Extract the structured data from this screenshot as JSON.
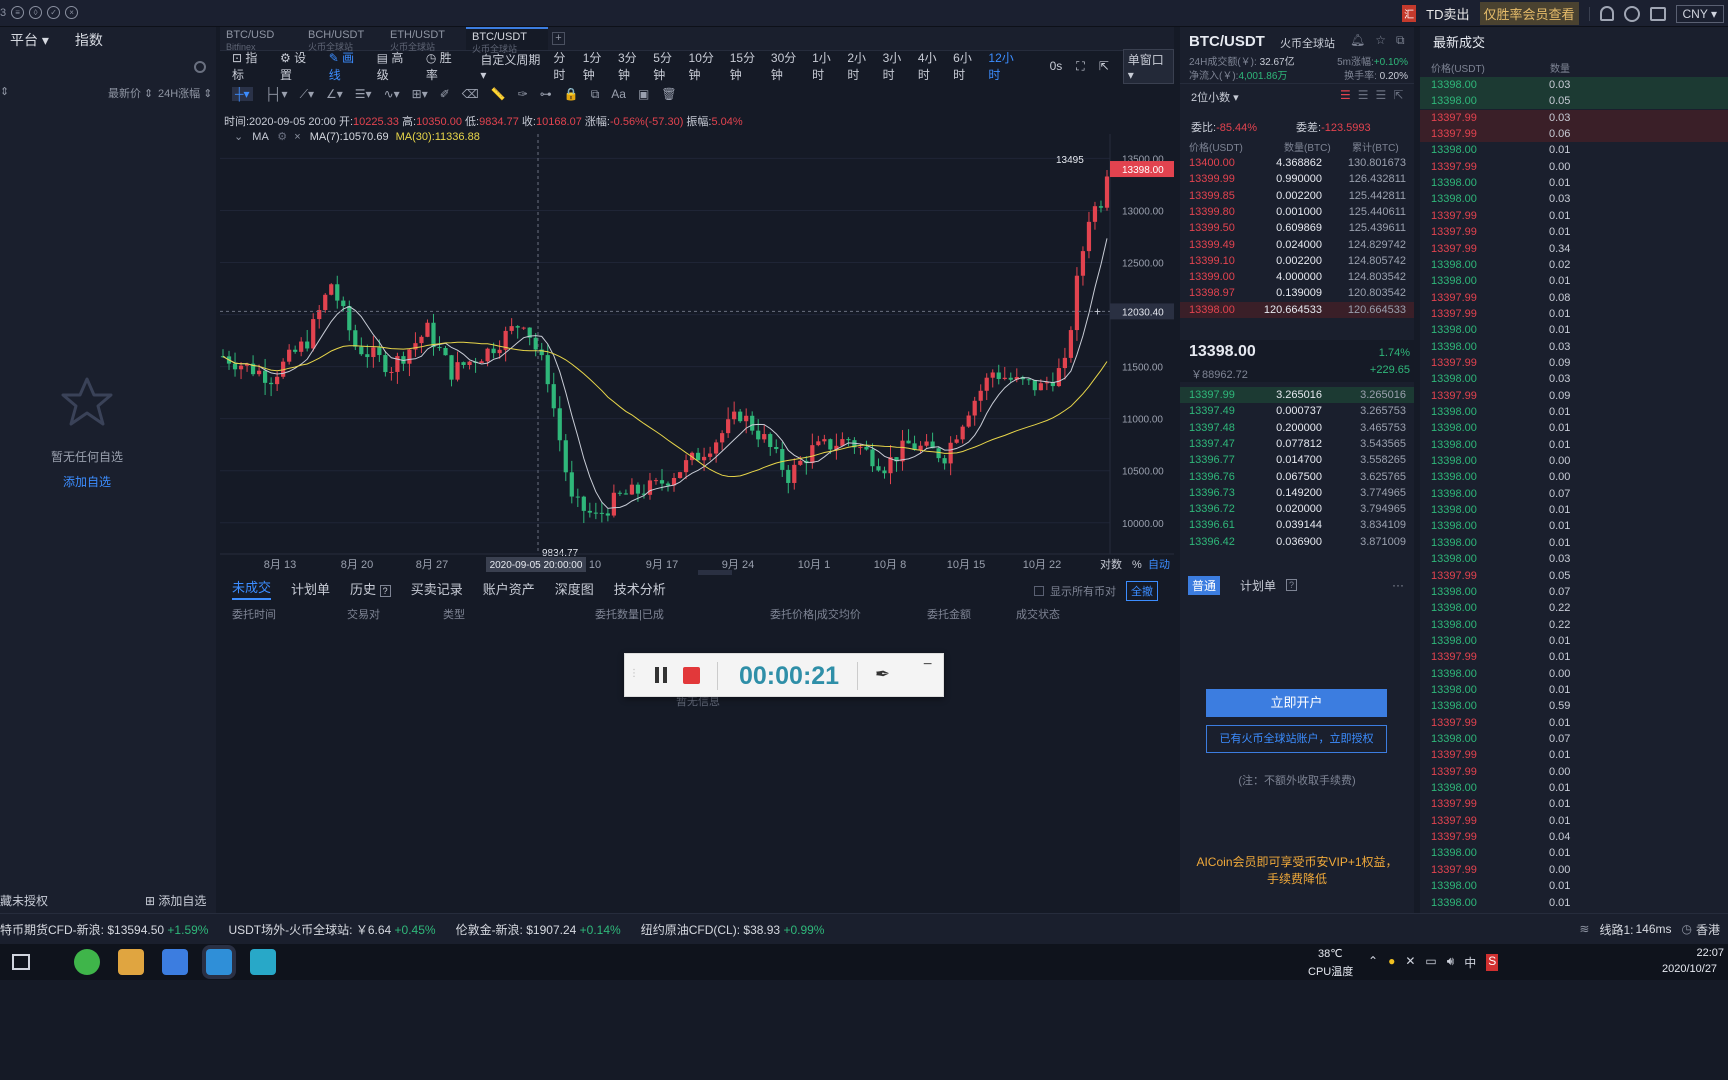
{
  "topbar": {
    "td_badge": "汇",
    "td_label": "TD卖出",
    "vip": "仅胜率会员查看",
    "currency": "CNY ▾"
  },
  "left": {
    "tabs": [
      "平台 ▾",
      "指数"
    ],
    "col_last": "最新价 ⇕",
    "col_change": "24H涨幅 ⇕",
    "empty_text": "暂无任何自选",
    "add_link": "添加自选",
    "bottom_left": "藏未授权",
    "bottom_add": "添加自选"
  },
  "chart": {
    "tabs": [
      {
        "name": "BTC/USD",
        "sub": "Bitfinex"
      },
      {
        "name": "BCH/USDT",
        "sub": "火币全球站"
      },
      {
        "name": "ETH/USDT",
        "sub": "火币全球站"
      },
      {
        "name": "BTC/USDT",
        "sub": "火币全球站"
      }
    ],
    "tools": [
      "指标",
      "设置",
      "画线",
      "高级",
      "胜率"
    ],
    "custom_period": "自定义周期 ▾",
    "periods": [
      "分时",
      "1分钟",
      "3分钟",
      "5分钟",
      "10分钟",
      "15分钟",
      "30分钟",
      "1小时",
      "2小时",
      "3小时",
      "4小时",
      "6小时",
      "12小时"
    ],
    "active_period": "12小时",
    "right_tools": {
      "zero": "0s",
      "single": "单窗口 ▾"
    },
    "ohlc": {
      "time": "时间:2020-09-05 20:00",
      "open_l": "开:",
      "open": "10225.33",
      "high_l": "高:",
      "high": "10350.00",
      "low_l": "低:",
      "low": "9834.77",
      "close_l": "收:",
      "close": "10168.07",
      "chg_l": "涨幅:",
      "chg": "-0.56%(-57.30)",
      "amp_l": "振幅:",
      "amp": "5.04%"
    },
    "ma": {
      "name": "MA",
      "ma7": "MA(7):10570.69",
      "ma30": "MA(30):11336.88"
    },
    "price_ticks": [
      "13500.00",
      "13000.00",
      "12500.00",
      "12000.00",
      "11500.00",
      "11000.00",
      "10500.00",
      "10000.00"
    ],
    "current_price": "13398.00",
    "cross_price": "12030.40",
    "max_label": "13495",
    "min_label": "9834.77",
    "date_ticks": [
      "8月 13",
      "8月 20",
      "8月 27",
      "10",
      "9月 17",
      "9月 24",
      "10月 1",
      "10月 8",
      "10月 15",
      "10月 22"
    ],
    "cross_date": "2020-09-05 20:00:00",
    "axis_opts": [
      "对数",
      "%",
      "自动"
    ]
  },
  "chart_data": {
    "type": "candlestick",
    "ylim": [
      9700,
      13600
    ],
    "annotations": {
      "max": 13495,
      "min": 9834.77,
      "last": 13398.0
    }
  },
  "orders": {
    "tabs": [
      "未成交",
      "计划单",
      "历史",
      "买卖记录",
      "账户资产",
      "深度图",
      "技术分析"
    ],
    "show_all": "显示所有币对",
    "cancel_all": "全撤",
    "cols": [
      "委托时间",
      "交易对",
      "类型",
      "委托数量|已成",
      "委托价格|成交均价",
      "委托金额",
      "成交状态"
    ],
    "empty": "暂无信息"
  },
  "recorder": {
    "time": "00:00:21"
  },
  "market": {
    "pair": "BTC/USDT",
    "exchange": "火币全球站",
    "vol_label": "24H成交额(￥):",
    "vol": "32.67亿",
    "change5m_label": "5m涨幅:",
    "change5m": "+0.10%",
    "inflow_label": "净流入(￥):",
    "inflow": "4,001.86万",
    "turnover_label": "换手率:",
    "turnover": "0.20%",
    "decimals": "2位小数 ▾",
    "wb_label": "委比:",
    "wb": "-85.44%",
    "wc_label": "委差:",
    "wc": "-123.5993",
    "cols": [
      "价格(USDT)",
      "数量(BTC)",
      "累计(BTC)"
    ],
    "asks": [
      [
        "13400.00",
        "4.368862",
        "130.801673"
      ],
      [
        "13399.99",
        "0.990000",
        "126.432811"
      ],
      [
        "13399.85",
        "0.002200",
        "125.442811"
      ],
      [
        "13399.80",
        "0.001000",
        "125.440611"
      ],
      [
        "13399.50",
        "0.609869",
        "125.439611"
      ],
      [
        "13399.49",
        "0.024000",
        "124.829742"
      ],
      [
        "13399.10",
        "0.002200",
        "124.805742"
      ],
      [
        "13399.00",
        "4.000000",
        "124.803542"
      ],
      [
        "13398.97",
        "0.139009",
        "120.803542"
      ],
      [
        "13398.00",
        "120.664533",
        "120.664533"
      ]
    ],
    "mid_price": "13398.00",
    "mid_cny": "￥88962.72",
    "mid_pct": "1.74%",
    "mid_chg": "+229.65",
    "bids": [
      [
        "13397.99",
        "3.265016",
        "3.265016"
      ],
      [
        "13397.49",
        "0.000737",
        "3.265753"
      ],
      [
        "13397.48",
        "0.200000",
        "3.465753"
      ],
      [
        "13397.47",
        "0.077812",
        "3.543565"
      ],
      [
        "13396.77",
        "0.014700",
        "3.558265"
      ],
      [
        "13396.76",
        "0.067500",
        "3.625765"
      ],
      [
        "13396.73",
        "0.149200",
        "3.774965"
      ],
      [
        "13396.72",
        "0.020000",
        "3.794965"
      ],
      [
        "13396.61",
        "0.039144",
        "3.834109"
      ],
      [
        "13396.42",
        "0.036900",
        "3.871009"
      ]
    ],
    "trade_tabs": [
      "普通",
      "计划单"
    ],
    "open_btn": "立即开户",
    "auth_btn": "已有火币全球站账户，立即授权",
    "note": "(注：不额外收取手续费)",
    "promo1": "AICoin会员即可享受币安VIP+1权益，",
    "promo2": "手续费降低"
  },
  "trades": {
    "title": "最新成交",
    "col_price": "价格(USDT)",
    "col_qty": "数量",
    "rows": [
      [
        "13398.00",
        "0.03",
        "g"
      ],
      [
        "13398.00",
        "0.05",
        "g"
      ],
      [
        "13397.99",
        "0.03",
        "r"
      ],
      [
        "13397.99",
        "0.06",
        "r"
      ],
      [
        "13398.00",
        "0.01",
        "g"
      ],
      [
        "13397.99",
        "0.00",
        "r"
      ],
      [
        "13398.00",
        "0.01",
        "g"
      ],
      [
        "13398.00",
        "0.03",
        "g"
      ],
      [
        "13397.99",
        "0.01",
        "r"
      ],
      [
        "13397.99",
        "0.01",
        "r"
      ],
      [
        "13397.99",
        "0.34",
        "r"
      ],
      [
        "13398.00",
        "0.02",
        "g"
      ],
      [
        "13398.00",
        "0.01",
        "g"
      ],
      [
        "13397.99",
        "0.08",
        "r"
      ],
      [
        "13397.99",
        "0.01",
        "r"
      ],
      [
        "13398.00",
        "0.01",
        "g"
      ],
      [
        "13398.00",
        "0.03",
        "g"
      ],
      [
        "13397.99",
        "0.09",
        "r"
      ],
      [
        "13398.00",
        "0.03",
        "g"
      ],
      [
        "13397.99",
        "0.09",
        "r"
      ],
      [
        "13398.00",
        "0.01",
        "g"
      ],
      [
        "13398.00",
        "0.01",
        "g"
      ],
      [
        "13398.00",
        "0.01",
        "g"
      ],
      [
        "13398.00",
        "0.00",
        "g"
      ],
      [
        "13398.00",
        "0.00",
        "g"
      ],
      [
        "13398.00",
        "0.07",
        "g"
      ],
      [
        "13398.00",
        "0.01",
        "g"
      ],
      [
        "13398.00",
        "0.01",
        "g"
      ],
      [
        "13398.00",
        "0.01",
        "g"
      ],
      [
        "13398.00",
        "0.03",
        "g"
      ],
      [
        "13397.99",
        "0.05",
        "r"
      ],
      [
        "13398.00",
        "0.07",
        "g"
      ],
      [
        "13398.00",
        "0.22",
        "g"
      ],
      [
        "13398.00",
        "0.22",
        "g"
      ],
      [
        "13398.00",
        "0.01",
        "g"
      ],
      [
        "13397.99",
        "0.01",
        "r"
      ],
      [
        "13398.00",
        "0.00",
        "g"
      ],
      [
        "13398.00",
        "0.01",
        "g"
      ],
      [
        "13398.00",
        "0.59",
        "g"
      ],
      [
        "13397.99",
        "0.01",
        "r"
      ],
      [
        "13398.00",
        "0.07",
        "g"
      ],
      [
        "13397.99",
        "0.01",
        "r"
      ],
      [
        "13397.99",
        "0.00",
        "r"
      ],
      [
        "13398.00",
        "0.01",
        "g"
      ],
      [
        "13397.99",
        "0.01",
        "r"
      ],
      [
        "13397.99",
        "0.01",
        "r"
      ],
      [
        "13397.99",
        "0.04",
        "r"
      ],
      [
        "13398.00",
        "0.01",
        "g"
      ],
      [
        "13397.99",
        "0.00",
        "r"
      ],
      [
        "13398.00",
        "0.01",
        "g"
      ],
      [
        "13398.00",
        "0.01",
        "g"
      ]
    ]
  },
  "ticker": {
    "items": [
      [
        "特币期货CFD-新浪:",
        "$13594.50",
        "+1.59%"
      ],
      [
        "USDT场外-火币全球站:",
        "￥6.64",
        "+0.45%"
      ],
      [
        "伦敦金-新浪:",
        "$1907.24",
        "+0.14%"
      ],
      [
        "纽约原油CFD(CL):",
        "$38.93",
        "+0.99%"
      ]
    ],
    "line": "线路1:",
    "ping": "146ms",
    "region": "香港"
  },
  "taskbar": {
    "temp": "38℃",
    "temp_label": "CPU温度",
    "ime": "中",
    "time": "22:07",
    "date": "2020/10/27"
  }
}
